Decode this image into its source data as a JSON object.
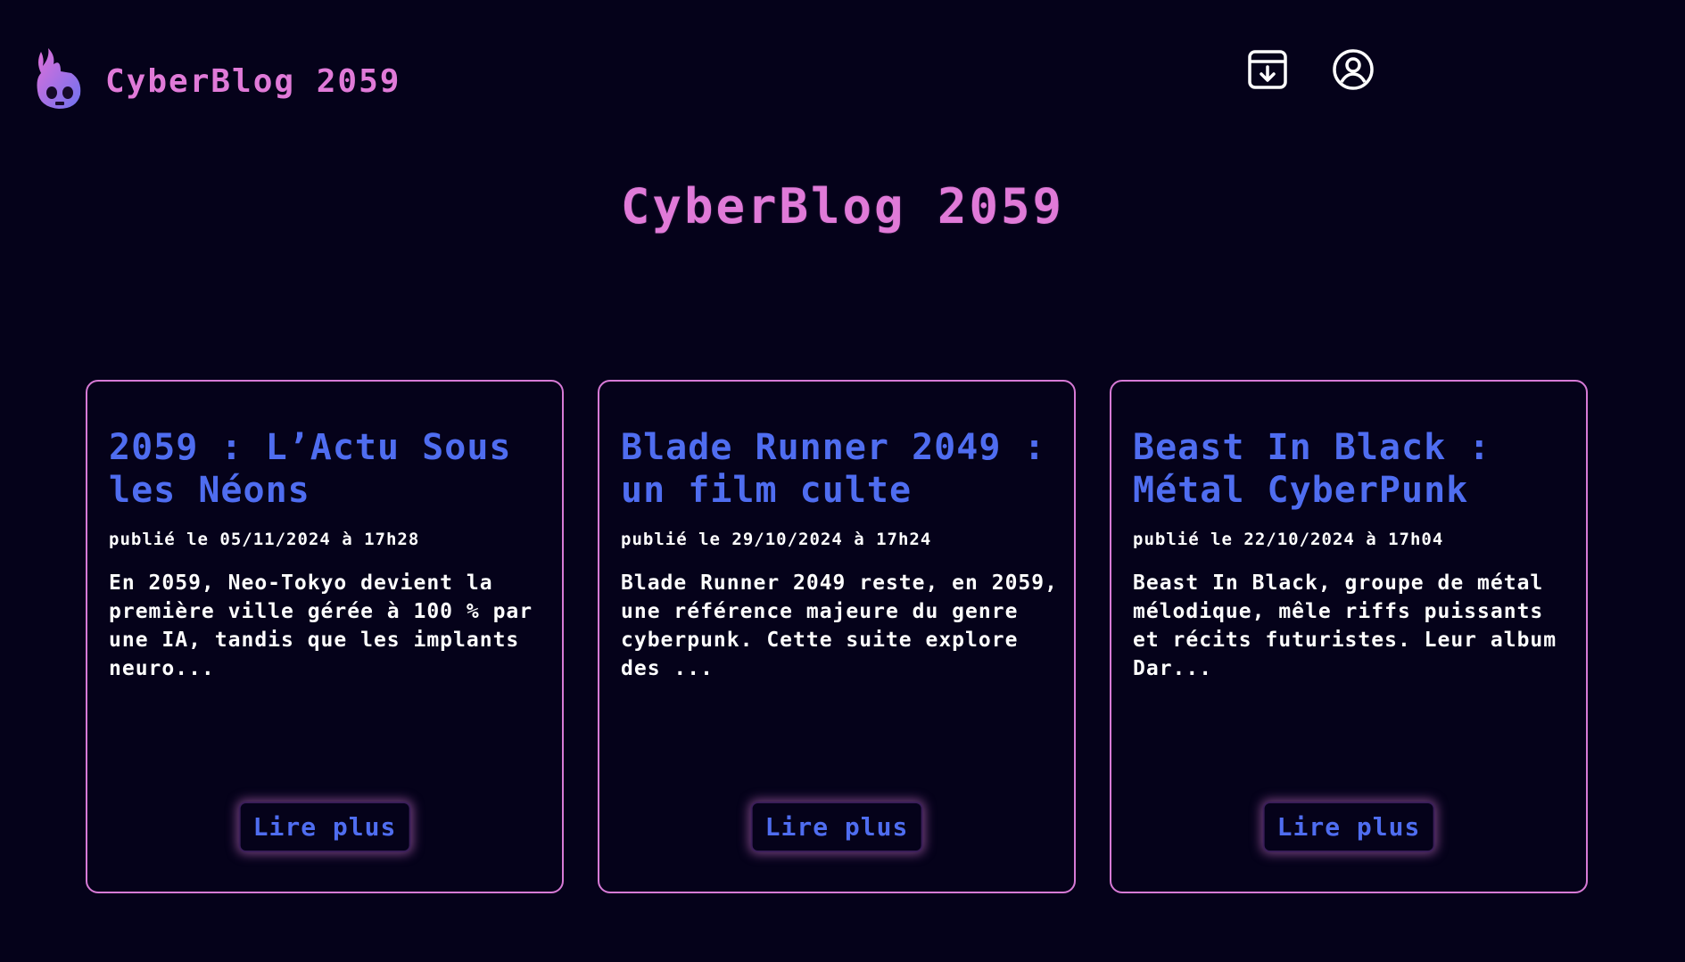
{
  "header": {
    "brand_name": "CyberBlog 2059",
    "archive_icon": "archive-download-icon",
    "account_icon": "user-circle-icon"
  },
  "hero": {
    "title": "CyberBlog 2059"
  },
  "colors": {
    "background": "#05021a",
    "accent_pink": "#e07ad8",
    "accent_blue": "#4f6df0",
    "text": "#ffffff"
  },
  "posts": [
    {
      "title": "2059 : L’Actu Sous les Néons",
      "date": "publié le 05/11/2024 à 17h28",
      "excerpt": "En 2059, Neo-Tokyo devient la première ville gérée à 100 % par une IA, tandis que les implants neuro...",
      "button_label": "Lire plus"
    },
    {
      "title": "Blade Runner 2049 : un film culte",
      "date": "publié le 29/10/2024 à 17h24",
      "excerpt": "Blade Runner 2049 reste, en 2059, une référence majeure du genre cyberpunk. Cette suite explore des ...",
      "button_label": "Lire plus"
    },
    {
      "title": "Beast In Black : Métal CyberPunk",
      "date": "publié le 22/10/2024 à 17h04",
      "excerpt": "Beast In Black, groupe de métal mélodique, mêle riffs puissants et récits futuristes. Leur album Dar...",
      "button_label": "Lire plus"
    }
  ]
}
